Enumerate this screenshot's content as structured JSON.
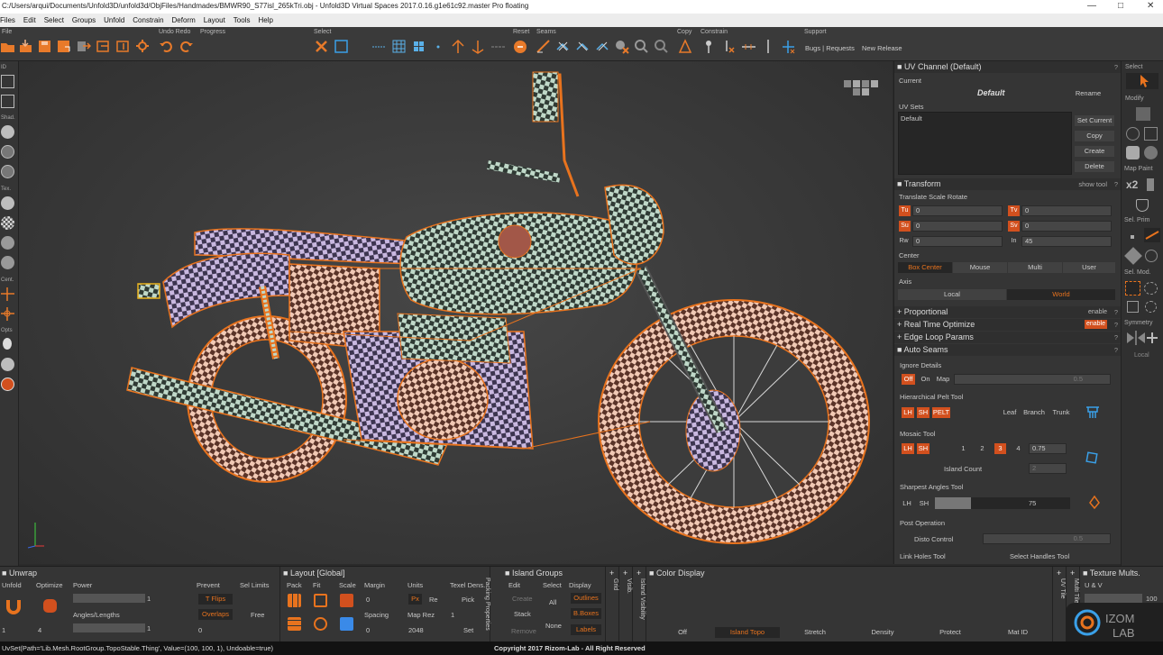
{
  "window": {
    "title": "C:/Users/arqui/Documents/Unfold3D/unfold3d/ObjFiles/Handmades/BMWR90_S77isl_265kTri.obj - Unfold3D Virtual Spaces 2017.0.16.g1e61c92.master Pro floating"
  },
  "menu": [
    "Files",
    "Edit",
    "Select",
    "Groups",
    "Unfold",
    "Constrain",
    "Deform",
    "Layout",
    "Tools",
    "Help"
  ],
  "toolbar": {
    "file": "File",
    "undo_redo": "Undo Redo",
    "progress": "Progress",
    "select": "Select",
    "reset": "Reset",
    "seams": "Seams",
    "copy": "Copy",
    "constrain": "Constrain",
    "support": "Support",
    "bugs": "Bugs | Requests",
    "new_release": "New Release"
  },
  "leftbar": {
    "id": "ID",
    "shad": "Shad.",
    "tex": "Tex.",
    "cent": "Cent.",
    "opts": "Opts"
  },
  "uv_channel": {
    "header": "UV Channel (Default)",
    "current_label": "Current",
    "current_value": "Default",
    "rename": "Rename",
    "uv_sets_label": "UV Sets",
    "uv_sets": [
      "Default"
    ],
    "set_current": "Set Current",
    "copy": "Copy",
    "create": "Create",
    "delete": "Delete"
  },
  "transform": {
    "header": "Transform",
    "show_tool": "show tool",
    "tsr": "Translate Scale Rotate",
    "tu_label": "Tu",
    "tu": "0",
    "tv_label": "Tv",
    "tv": "0",
    "su_label": "Su",
    "su": "0",
    "sv_label": "Sv",
    "sv": "0",
    "rw_label": "Rw",
    "rw": "0",
    "in_label": "In",
    "in": "45",
    "center_label": "Center",
    "centers": [
      "Box Center",
      "Mouse",
      "Multi",
      "User"
    ],
    "axis_label": "Axis",
    "axes": [
      "Local",
      "World"
    ]
  },
  "proportional": {
    "header": "Proportional",
    "state": "enable"
  },
  "rto": {
    "header": "Real Time Optimize",
    "state": "enable"
  },
  "edge_loop": {
    "header": "Edge Loop Params"
  },
  "auto_seams": {
    "header": "Auto Seams",
    "ignore_details": "Ignore Details",
    "off": "Off",
    "on": "On",
    "map": "Map",
    "ignore_value": "0.5",
    "pelt_label": "Hierarchical Pelt Tool",
    "lh": "LH",
    "sh": "SH",
    "pelt": "PELT",
    "leaf": "Leaf",
    "branch": "Branch",
    "trunk": "Trunk",
    "mosaic_label": "Mosaic Tool",
    "mosaic_nums": [
      "1",
      "2",
      "3",
      "4"
    ],
    "mosaic_value": "0.75",
    "island_count_label": "Island Count",
    "island_count": "2",
    "sharpest_label": "Sharpest Angles Tool",
    "sharpest_value": "75",
    "post_op": "Post Operation",
    "disto_label": "Disto Control",
    "disto_value": "0.5",
    "link_holes": "Link Holes Tool",
    "select_handles": "Select Handles Tool"
  },
  "farright": {
    "select": "Select",
    "modify": "Modify",
    "map_paint": "Map Paint",
    "x2": "x2",
    "sel_prim": "Sel. Prim",
    "sel_mod": "Sel. Mod.",
    "symmetry": "Symmetry",
    "local": "Local"
  },
  "unwrap": {
    "header": "Unwrap",
    "unfold": "Unfold",
    "optimize": "Optimize",
    "power": "Power",
    "power_value": "1",
    "angles": "Angles/Lengths",
    "angles_value": "1",
    "prevent": "Prevent",
    "t_flips": "T Flips",
    "overlaps": "Overlaps",
    "sel_limits": "Sel Limits",
    "free": "Free",
    "v1": "1",
    "v2": "4",
    "v3": "0"
  },
  "layout": {
    "header": "Layout [Global]",
    "pack": "Pack",
    "fit": "Fit",
    "scale": "Scale",
    "margin": "Margin",
    "margin_value": "0",
    "spacing": "Spacing",
    "spacing_value": "0",
    "units": "Units",
    "px": "Px",
    "re": "Re",
    "map_rez": "Map Rez",
    "map_rez_value": "2048",
    "texel": "Texel Dens.",
    "texel_value": "1",
    "pick": "Pick",
    "set": "Set",
    "packing_props": "Packing Properties"
  },
  "island_groups": {
    "header": "Island Groups",
    "edit": "Edit",
    "select": "Select",
    "display": "Display",
    "create": "Create",
    "all": "All",
    "stack": "Stack",
    "none": "None",
    "remove": "Remove",
    "outlines": "Outlines",
    "bboxes": "B.Boxes",
    "labels": "Labels",
    "grid": "Grid",
    "visib": "Visib.",
    "island_visibility": "Island Visibility"
  },
  "color_display": {
    "header": "Color Display",
    "modes": [
      "Off",
      "Island Topo",
      "Stretch",
      "Density",
      "Protect",
      "Mat ID"
    ],
    "active": "Island Topo",
    "uv_tile": "UV Tile",
    "multi_tile": "Multi Tile"
  },
  "texture_mults": {
    "header": "Texture Mults.",
    "uv": "U & V",
    "value": "100"
  },
  "status": {
    "left": "UvSet(Path='Lib.Mesh.RootGroup.TopoStable.Thing', Value=(100, 100, 1), Undoable=true)",
    "copyright": "Copyright 2017 Rizom-Lab - All Right Reserved"
  },
  "colors": {
    "accent": "#d2501e",
    "panel": "#353535",
    "viewport": "#3a3a3a"
  }
}
